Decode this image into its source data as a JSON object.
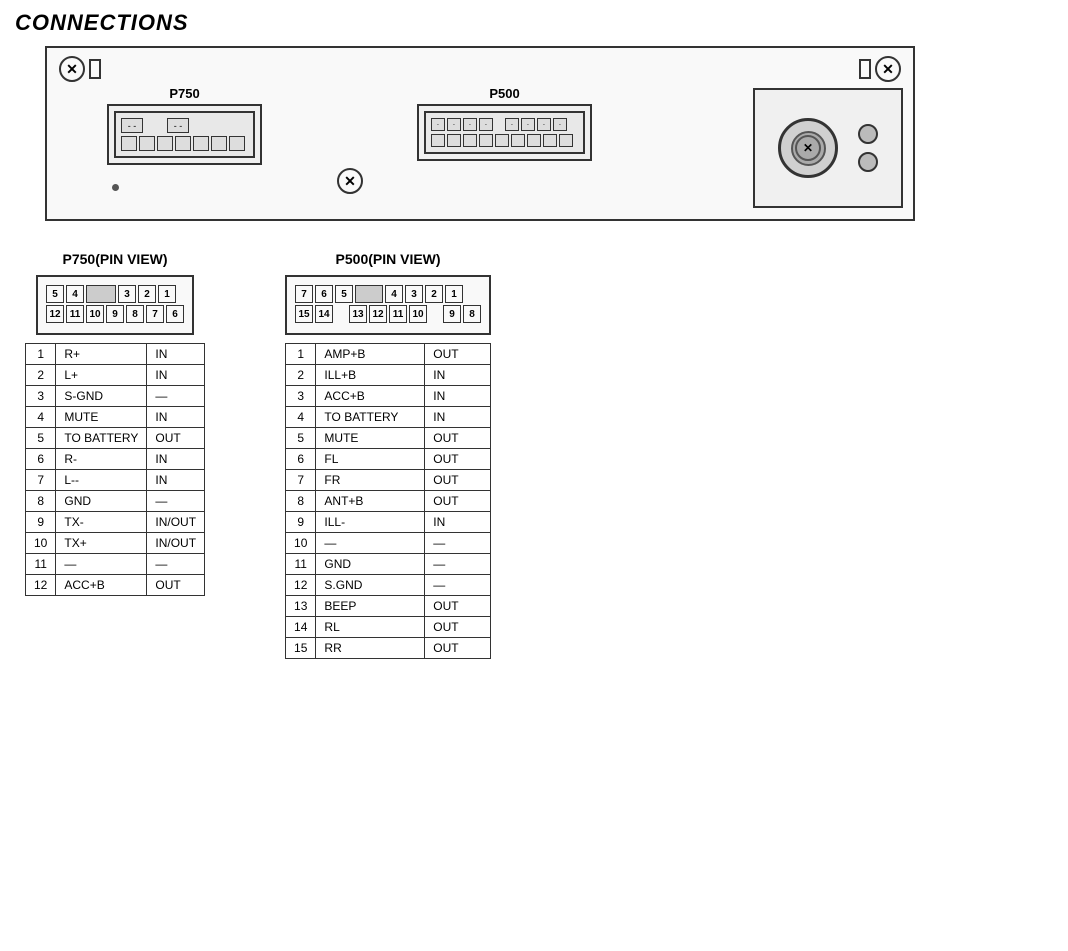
{
  "title": "CONNECTIONS",
  "connector_diagram": {
    "label_p750": "P750",
    "label_p500": "P500"
  },
  "p750_pin_view": {
    "label": "P750(PIN VIEW)",
    "row1": [
      "5",
      "4",
      "",
      "3",
      "2",
      "1"
    ],
    "row2": [
      "12",
      "11",
      "10",
      "9",
      "8",
      "7",
      "6"
    ],
    "pins": [
      {
        "num": "1",
        "name": "R+",
        "dir": "IN"
      },
      {
        "num": "2",
        "name": "L+",
        "dir": "IN"
      },
      {
        "num": "3",
        "name": "S-GND",
        "dir": "—"
      },
      {
        "num": "4",
        "name": "MUTE",
        "dir": "IN"
      },
      {
        "num": "5",
        "name": "TO BATTERY",
        "dir": "OUT"
      },
      {
        "num": "6",
        "name": "R-",
        "dir": "IN"
      },
      {
        "num": "7",
        "name": "L--",
        "dir": "IN"
      },
      {
        "num": "8",
        "name": "GND",
        "dir": "—"
      },
      {
        "num": "9",
        "name": "TX-",
        "dir": "IN/OUT"
      },
      {
        "num": "10",
        "name": "TX+",
        "dir": "IN/OUT"
      },
      {
        "num": "11",
        "name": "—",
        "dir": "—"
      },
      {
        "num": "12",
        "name": "ACC+B",
        "dir": "OUT"
      }
    ]
  },
  "p500_pin_view": {
    "label": "P500(PIN VIEW)",
    "row1": [
      "7",
      "6",
      "5",
      "",
      "4",
      "3",
      "2",
      "1"
    ],
    "row2": [
      "15",
      "14",
      "",
      "13",
      "12",
      "11",
      "10",
      "",
      "9",
      "8"
    ],
    "pins": [
      {
        "num": "1",
        "name": "AMP+B",
        "dir": "OUT"
      },
      {
        "num": "2",
        "name": "ILL+B",
        "dir": "IN"
      },
      {
        "num": "3",
        "name": "ACC+B",
        "dir": "IN"
      },
      {
        "num": "4",
        "name": "TO BATTERY",
        "dir": "IN"
      },
      {
        "num": "5",
        "name": "MUTE",
        "dir": "OUT"
      },
      {
        "num": "6",
        "name": "FL",
        "dir": "OUT"
      },
      {
        "num": "7",
        "name": "FR",
        "dir": "OUT"
      },
      {
        "num": "8",
        "name": "ANT+B",
        "dir": "OUT"
      },
      {
        "num": "9",
        "name": "ILL-",
        "dir": "IN"
      },
      {
        "num": "10",
        "name": "—",
        "dir": "—"
      },
      {
        "num": "11",
        "name": "GND",
        "dir": "—"
      },
      {
        "num": "12",
        "name": "S.GND",
        "dir": "—"
      },
      {
        "num": "13",
        "name": "BEEP",
        "dir": "OUT"
      },
      {
        "num": "14",
        "name": "RL",
        "dir": "OUT"
      },
      {
        "num": "15",
        "name": "RR",
        "dir": "OUT"
      }
    ]
  }
}
